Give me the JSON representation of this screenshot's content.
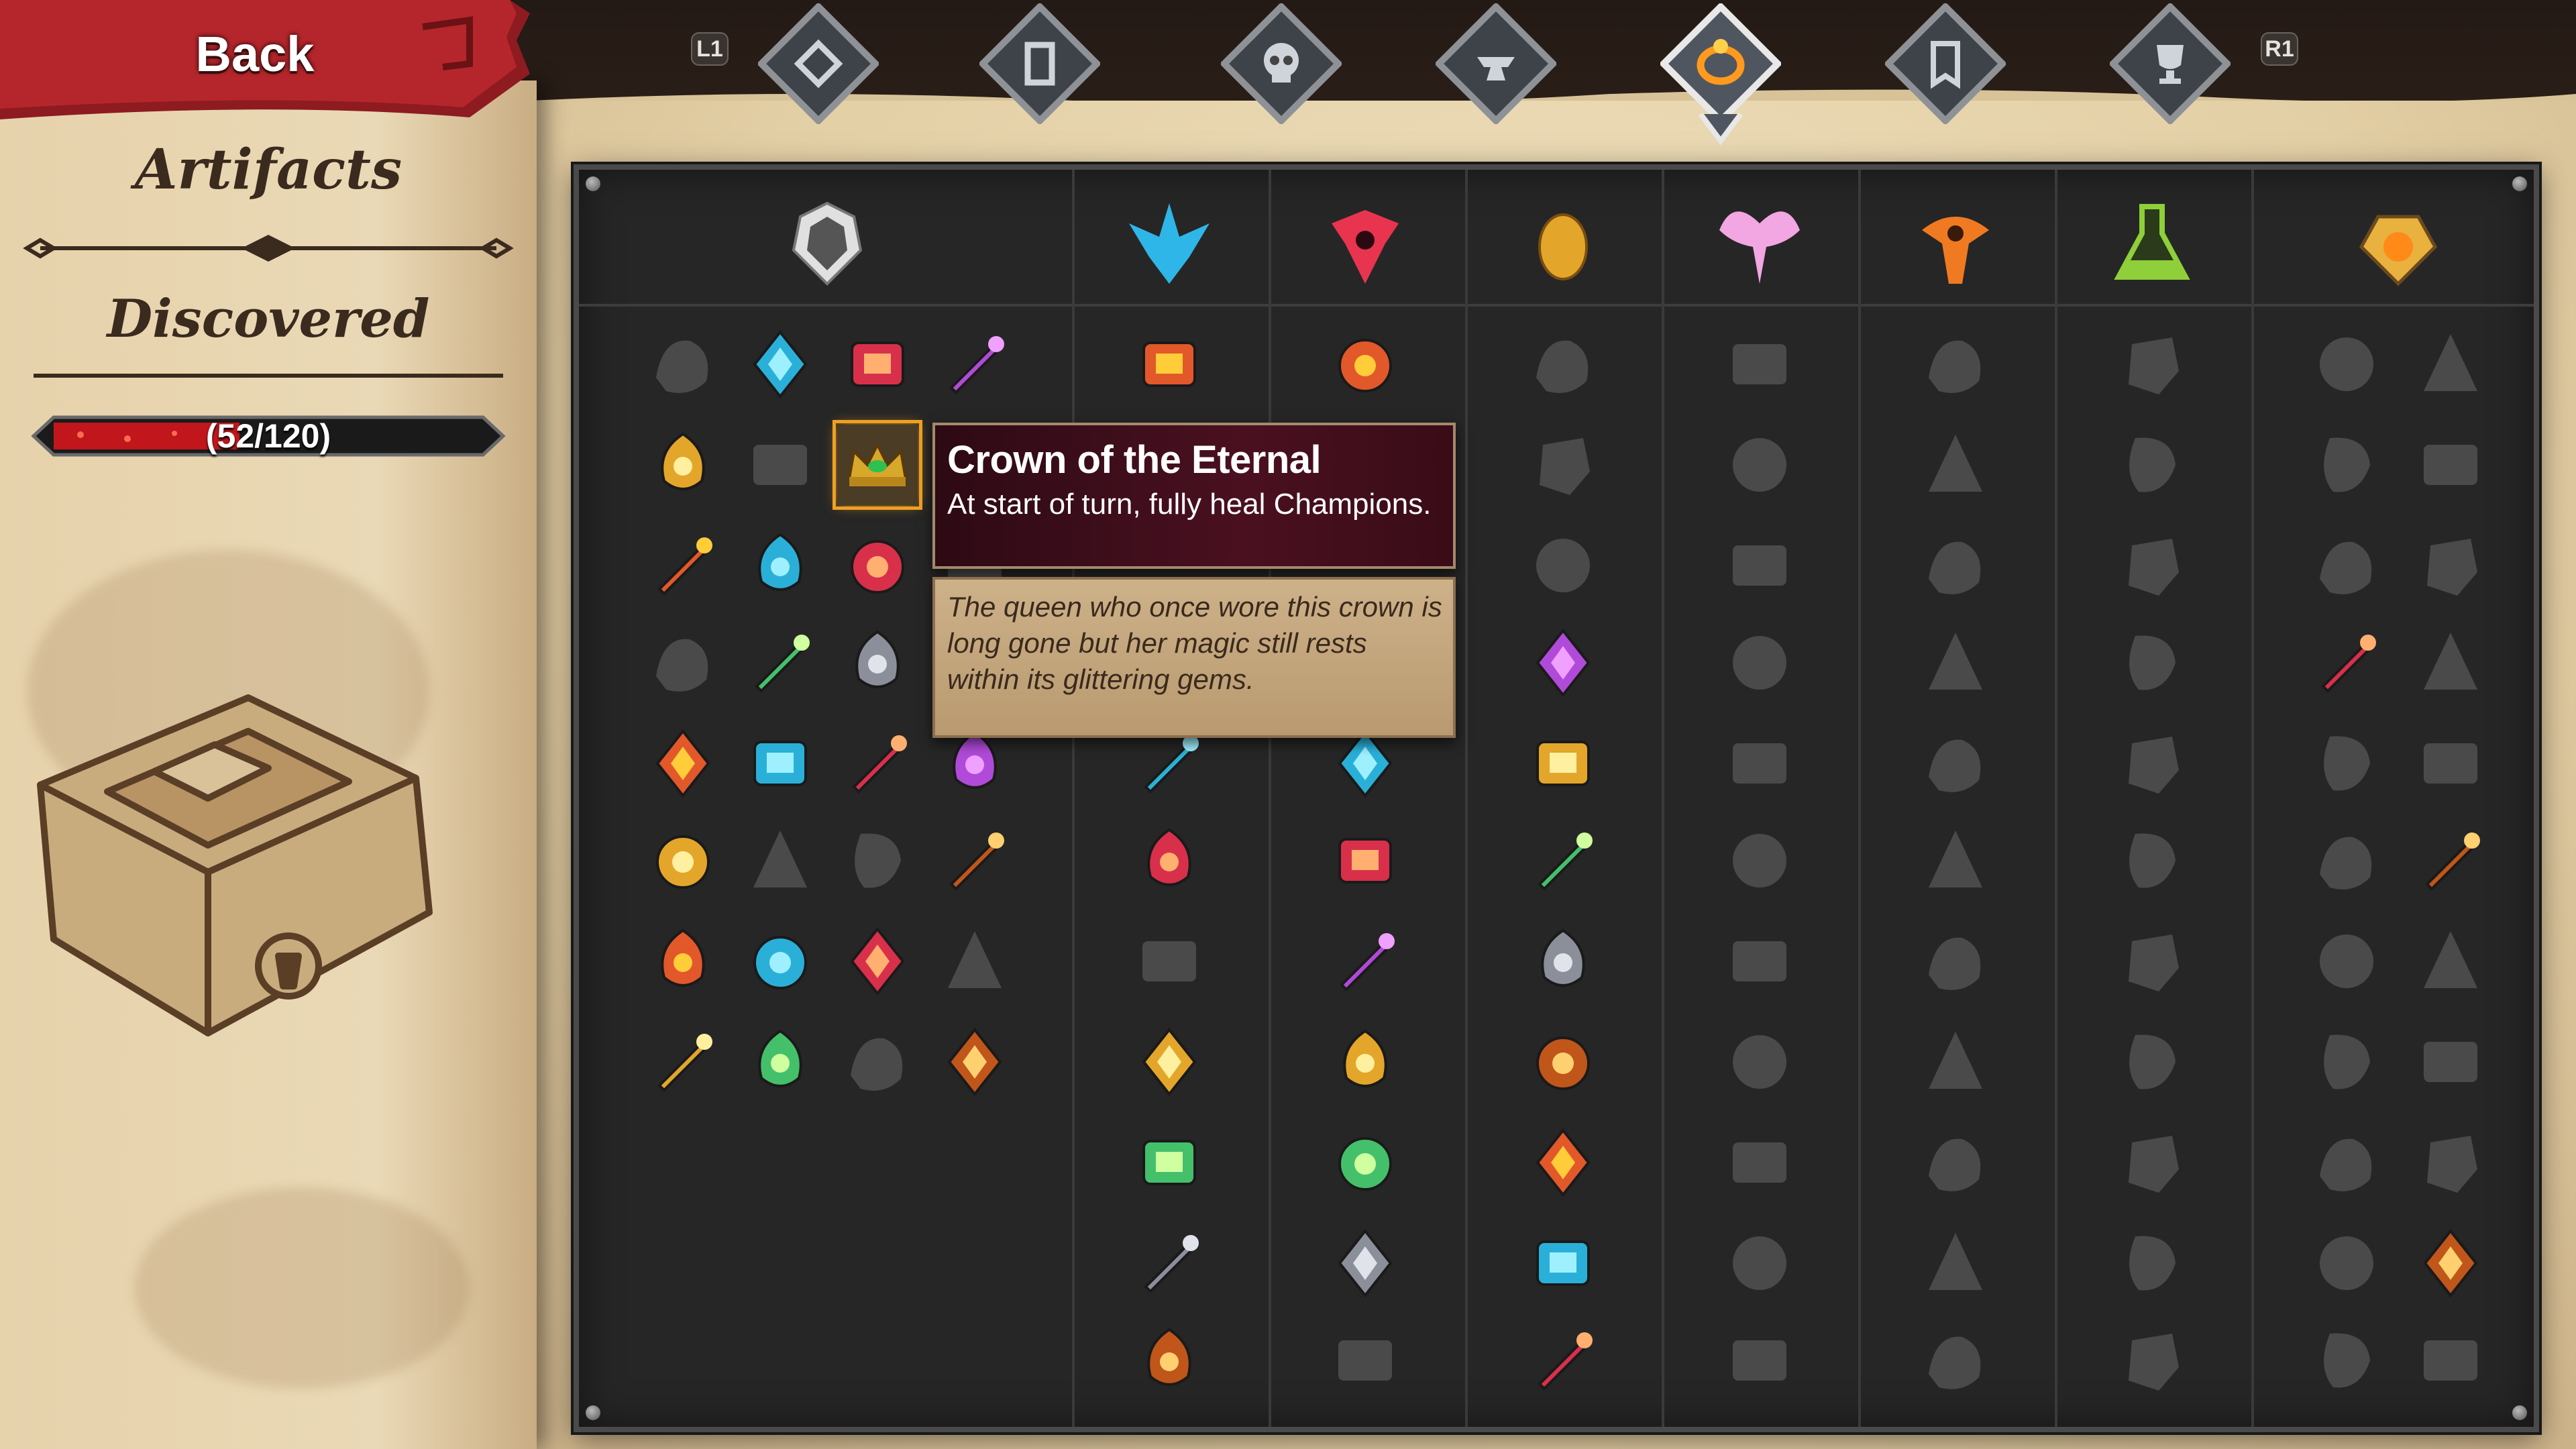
{
  "header": {
    "back_label": "Back",
    "left_shoulder": "L1",
    "right_shoulder": "R1",
    "tabs": [
      {
        "icon": "diamond-icon",
        "selected": false
      },
      {
        "icon": "card-icon",
        "selected": false
      },
      {
        "icon": "skull-icon",
        "selected": false
      },
      {
        "icon": "anvil-icon",
        "selected": false
      },
      {
        "icon": "ring-icon",
        "selected": true
      },
      {
        "icon": "banner-icon",
        "selected": false
      },
      {
        "icon": "trophy-icon",
        "selected": false
      }
    ]
  },
  "sidebar": {
    "title": "Artifacts",
    "subtitle": "Discovered",
    "progress_text": "(52/120)",
    "progress_fraction": 0.433,
    "illustration": "locked-chest-illustration"
  },
  "collection": {
    "columns": [
      {
        "icon": "neutral-crest-icon",
        "color": "#e0e0e0"
      },
      {
        "icon": "blue-faction-crest-icon",
        "color": "#2fb6e8"
      },
      {
        "icon": "red-faction-crest-icon",
        "color": "#e8344f"
      },
      {
        "icon": "golden-egg-icon",
        "color": "#e3a62a"
      },
      {
        "icon": "pink-winged-crest-icon",
        "color": "#f2a6e2"
      },
      {
        "icon": "orange-eye-crest-icon",
        "color": "#f07a22"
      },
      {
        "icon": "green-flask-icon",
        "color": "#8ecf3a"
      },
      {
        "icon": "amber-gem-icon",
        "color": "#e9b13e"
      }
    ]
  },
  "tooltip": {
    "title": "Crown of the Eternal",
    "effect": "At start of turn, fully heal Champions.",
    "lore": "The queen who once wore this crown is long gone but her magic still rests within its glittering gems."
  },
  "colors": {
    "panel": "#262626",
    "parchment": "#e8d5ae",
    "selection": "#f0a020",
    "undiscovered": "#4a4a4a"
  }
}
